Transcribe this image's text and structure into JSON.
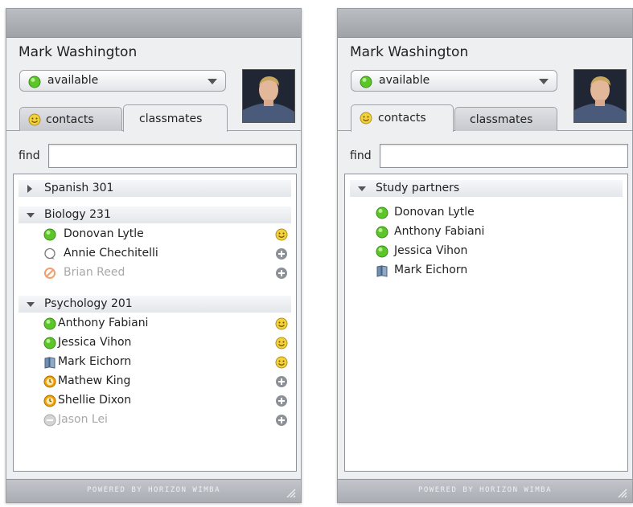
{
  "panels": [
    {
      "user_name": "Mark Washington",
      "status": {
        "label": "available",
        "icon": "green-dot-icon"
      },
      "tabs": [
        {
          "label": "contacts",
          "icon": "smiley-icon",
          "active": false
        },
        {
          "label": "classmates",
          "active": true
        }
      ],
      "find_label": "find",
      "find_value": "",
      "groups": [
        {
          "name": "Spanish 301",
          "expanded": false,
          "members": []
        },
        {
          "name": "Biology 231",
          "expanded": true,
          "members": [
            {
              "name": "Donovan Lytle",
              "status": "online",
              "action": "smiley"
            },
            {
              "name": "Annie Chechitelli",
              "status": "idle-bubble",
              "action": "add"
            },
            {
              "name": "Brian Reed",
              "status": "blocked",
              "action": "add",
              "dim": true
            }
          ]
        },
        {
          "name": "Psychology 201",
          "expanded": true,
          "members": [
            {
              "name": "Anthony Fabiani",
              "status": "online",
              "action": "smiley"
            },
            {
              "name": "Jessica Vihon",
              "status": "online",
              "action": "smiley"
            },
            {
              "name": "Mark Eichorn",
              "status": "book",
              "action": "smiley"
            },
            {
              "name": "Mathew King",
              "status": "away",
              "action": "add"
            },
            {
              "name": "Shellie Dixon",
              "status": "away",
              "action": "add"
            },
            {
              "name": "Jason Lei",
              "status": "offline",
              "action": "add",
              "dim": true
            }
          ]
        }
      ],
      "footer": "POWERED BY HORIZON WIMBA"
    },
    {
      "user_name": "Mark Washington",
      "status": {
        "label": "available",
        "icon": "green-dot-icon"
      },
      "tabs": [
        {
          "label": "contacts",
          "icon": "smiley-icon",
          "active": true
        },
        {
          "label": "classmates",
          "active": false
        }
      ],
      "find_label": "find",
      "find_value": "",
      "groups": [
        {
          "name": "Study partners",
          "expanded": true,
          "members": [
            {
              "name": "Donovan Lytle",
              "status": "online"
            },
            {
              "name": "Anthony Fabiani",
              "status": "online"
            },
            {
              "name": "Jessica Vihon",
              "status": "online"
            },
            {
              "name": "Mark Eichorn",
              "status": "book"
            }
          ]
        }
      ],
      "footer": "POWERED BY HORIZON WIMBA"
    }
  ],
  "colors": {
    "online": "#5cc52a",
    "away": "#f0a000",
    "blocked": "#f0a070",
    "offline": "#c8c8c8",
    "smiley": "#f2d23c",
    "add": "#8c9198"
  }
}
